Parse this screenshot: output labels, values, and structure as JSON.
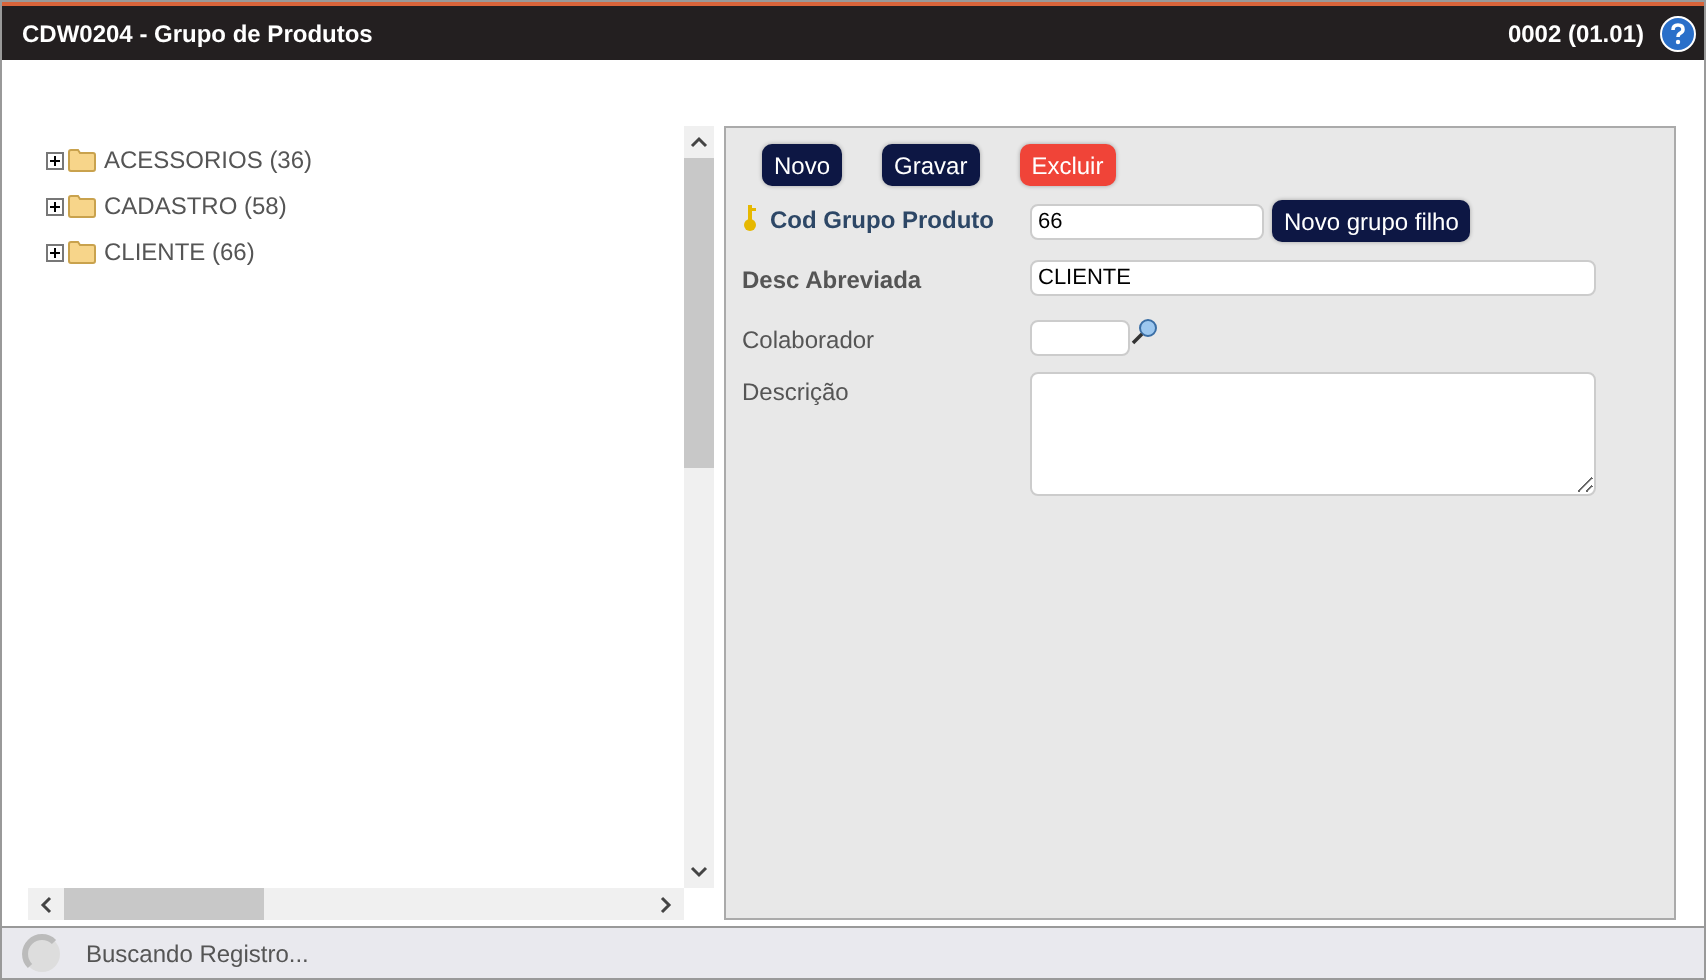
{
  "window": {
    "title": "CDW0204 - Grupo de Produtos",
    "version": "0002 (01.01)"
  },
  "tree": {
    "items": [
      {
        "label": "ACESSORIOS (36)",
        "expanded": false
      },
      {
        "label": "CADASTRO (58)",
        "expanded": false
      },
      {
        "label": "CLIENTE (66)",
        "expanded": false
      }
    ]
  },
  "toolbar": {
    "buttons": [
      {
        "label": "Novo",
        "kind": "primary"
      },
      {
        "label": "Gravar",
        "kind": "primary"
      },
      {
        "label": "Excluir",
        "kind": "danger"
      }
    ]
  },
  "form": {
    "fields": [
      {
        "label": "Cod Grupo Produto",
        "kind": "key",
        "required": true,
        "value": "66",
        "button": "Novo grupo filho"
      },
      {
        "label": "Desc Abreviada",
        "kind": "text",
        "required": true,
        "value": "CLIENTE"
      },
      {
        "label": "Colaborador",
        "kind": "lookup",
        "required": false
      },
      {
        "label": "Descrição",
        "kind": "textarea",
        "required": false
      }
    ]
  },
  "status_bar": {
    "text": "Buscando Registro..."
  }
}
